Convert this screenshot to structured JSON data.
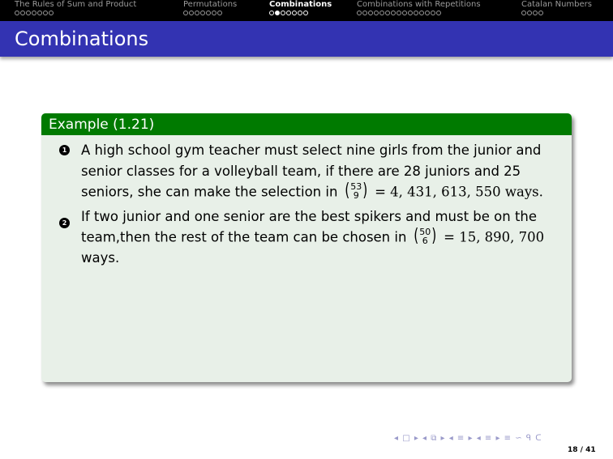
{
  "nav": {
    "sections": [
      {
        "title": "The Rules of Sum and Product",
        "dots": 7,
        "filled": 0,
        "active": false
      },
      {
        "title": "Permutations",
        "dots": 7,
        "filled": 0,
        "active": false
      },
      {
        "title": "Combinations",
        "dots": 7,
        "filled": 1,
        "active": true
      },
      {
        "title": "Combinations with Repetitions",
        "dots": 15,
        "filled": 0,
        "active": false
      },
      {
        "title": "Catalan Numbers",
        "dots": 4,
        "filled": 0,
        "active": false
      }
    ]
  },
  "frame": {
    "title": "Combinations"
  },
  "colors": {
    "navbar_bg": "#000000",
    "titlebar_bg": "#3333b2",
    "block_header_bg": "#007a00",
    "block_body_bg": "#e8f0e8"
  },
  "block": {
    "title": "Example (1.21)",
    "items": [
      {
        "marker": "1",
        "line1": "A high school gym teacher must select nine girls from the junior and",
        "line2": "senior classes for a volleyball team, if there are 28 juniors and 25",
        "line3_pre": "seniors, she can make the selection in",
        "binom_top": "53",
        "binom_bottom": "9",
        "line3_post": "= 4, 431, 613, 550 ways."
      },
      {
        "marker": "2",
        "line1": "If two junior and one senior are the best spikers and must be on the",
        "line2_pre": "team,then the rest of the team can be chosen in",
        "binom_top": "50",
        "binom_bottom": "6",
        "line2_post": "= 15, 890, 700",
        "line3": "ways."
      }
    ]
  },
  "footer": {
    "nav_symbols": "◂ □ ▸ ◂ ⧉ ▸ ◂ ≡ ▸ ◂ ≡ ▸   ≡   ∽ ᑫ ᑕ",
    "page": "18 / 41"
  }
}
